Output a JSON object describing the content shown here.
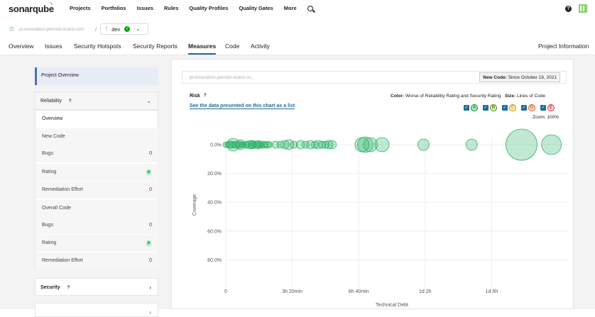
{
  "topnav": {
    "logo": "sonarqube",
    "items": [
      "Projects",
      "Portfolios",
      "Issues",
      "Rules",
      "Quality Profiles",
      "Quality Gates",
      "More"
    ]
  },
  "project": {
    "key": "pi-innovation.pernod-ricard.com",
    "branch": "dev"
  },
  "tabs": [
    "Overview",
    "Issues",
    "Security Hotspots",
    "Security Reports",
    "Measures",
    "Code",
    "Activity"
  ],
  "active_tab": "Measures",
  "project_information": "Project Information",
  "sidebar": {
    "project_overview": "Project Overview",
    "reliability": "Reliability",
    "overview": "Overview",
    "new_code": "New Code",
    "overall_code": "Overall Code",
    "security": "Security",
    "new_rows": [
      {
        "label": "Bugs",
        "value": "0"
      },
      {
        "label": "Rating",
        "value": "A"
      },
      {
        "label": "Remediation Effort",
        "value": "0"
      }
    ],
    "overall_rows": [
      {
        "label": "Bugs",
        "value": "0"
      },
      {
        "label": "Rating",
        "value": "A"
      },
      {
        "label": "Remediation Effort",
        "value": "0"
      }
    ]
  },
  "main": {
    "key": "pi-innovation.pernod-ricard.co...",
    "new_code_label": "New Code:",
    "new_code_value": "Since October 19, 2021",
    "risk": "Risk",
    "link": "See the data presented on this chart as a list",
    "color_label": "Color:",
    "color_value": "Worse of Reliability Rating and Security Rating",
    "size_label": "Size:",
    "size_value": "Lines of Code",
    "zoom": "Zoom: 100%",
    "ratings": [
      {
        "letter": "A",
        "fg": "#008a25",
        "bg": "#b6eccc"
      },
      {
        "letter": "B",
        "fg": "#4e8200",
        "bg": "#e8f6c9"
      },
      {
        "letter": "C",
        "fg": "#b98d00",
        "bg": "#fff1c7"
      },
      {
        "letter": "D",
        "fg": "#d05c1a",
        "bg": "#fde0cc"
      },
      {
        "letter": "E",
        "fg": "#d02f3a",
        "bg": "#fed9dc"
      }
    ]
  },
  "chart_data": {
    "type": "scatter",
    "xlabel": "Technical Debt",
    "ylabel": "Coverage",
    "x_tick_labels": [
      "0",
      "3h 20min",
      "6h 40min",
      "1d 2h",
      "1d 5h"
    ],
    "x_ticks_minutes": [
      0,
      200,
      400,
      600,
      800
    ],
    "y_tick_labels": [
      "0.0%",
      "20.0%",
      "40.0%",
      "60.0%",
      "80.0%"
    ],
    "y_ticks": [
      0,
      20,
      40,
      60,
      80
    ],
    "xlim": [
      0,
      1000
    ],
    "ylim": [
      0,
      100
    ],
    "y_inverted": true,
    "color": "#33b36b",
    "points": [
      {
        "x": 0,
        "y": 0,
        "size": 4
      },
      {
        "x": 6,
        "y": 0,
        "size": 4
      },
      {
        "x": 12,
        "y": 0,
        "size": 5
      },
      {
        "x": 18,
        "y": 0,
        "size": 5
      },
      {
        "x": 24,
        "y": 0,
        "size": 4
      },
      {
        "x": 30,
        "y": 0,
        "size": 5
      },
      {
        "x": 36,
        "y": 0,
        "size": 4
      },
      {
        "x": 42,
        "y": 0,
        "size": 5
      },
      {
        "x": 48,
        "y": 0,
        "size": 4
      },
      {
        "x": 54,
        "y": 0,
        "size": 4
      },
      {
        "x": 60,
        "y": 0,
        "size": 5
      },
      {
        "x": 66,
        "y": 0,
        "size": 4
      },
      {
        "x": 72,
        "y": 0,
        "size": 6
      },
      {
        "x": 78,
        "y": 0,
        "size": 5
      },
      {
        "x": 84,
        "y": 0,
        "size": 4
      },
      {
        "x": 90,
        "y": 0,
        "size": 5
      },
      {
        "x": 96,
        "y": 0,
        "size": 5
      },
      {
        "x": 102,
        "y": 0,
        "size": 4
      },
      {
        "x": 108,
        "y": 0,
        "size": 4
      },
      {
        "x": 114,
        "y": 0,
        "size": 5
      },
      {
        "x": 120,
        "y": 0,
        "size": 4
      },
      {
        "x": 126,
        "y": 0,
        "size": 5
      },
      {
        "x": 132,
        "y": 0,
        "size": 4
      },
      {
        "x": 22,
        "y": 0,
        "size": 9
      },
      {
        "x": 44,
        "y": 0,
        "size": 7
      },
      {
        "x": 80,
        "y": 0,
        "size": 6
      },
      {
        "x": 100,
        "y": 0,
        "size": 6
      },
      {
        "x": 150,
        "y": 0,
        "size": 5
      },
      {
        "x": 165,
        "y": 0,
        "size": 5
      },
      {
        "x": 178,
        "y": 0,
        "size": 6
      },
      {
        "x": 190,
        "y": 0,
        "size": 7
      },
      {
        "x": 205,
        "y": 0,
        "size": 5
      },
      {
        "x": 225,
        "y": 0,
        "size": 6
      },
      {
        "x": 240,
        "y": 0,
        "size": 5
      },
      {
        "x": 255,
        "y": 0,
        "size": 6
      },
      {
        "x": 268,
        "y": 0,
        "size": 5
      },
      {
        "x": 278,
        "y": 0,
        "size": 6
      },
      {
        "x": 290,
        "y": 0,
        "size": 5
      },
      {
        "x": 300,
        "y": 0,
        "size": 5
      },
      {
        "x": 310,
        "y": 0,
        "size": 6
      },
      {
        "x": 320,
        "y": 0,
        "size": 6
      },
      {
        "x": 410,
        "y": 0,
        "size": 10
      },
      {
        "x": 420,
        "y": 0,
        "size": 11
      },
      {
        "x": 435,
        "y": 0,
        "size": 10
      },
      {
        "x": 470,
        "y": 0,
        "size": 10
      },
      {
        "x": 595,
        "y": 0,
        "size": 8
      },
      {
        "x": 740,
        "y": 0,
        "size": 8
      },
      {
        "x": 890,
        "y": 0,
        "size": 22
      },
      {
        "x": 980,
        "y": 0,
        "size": 14
      }
    ]
  }
}
